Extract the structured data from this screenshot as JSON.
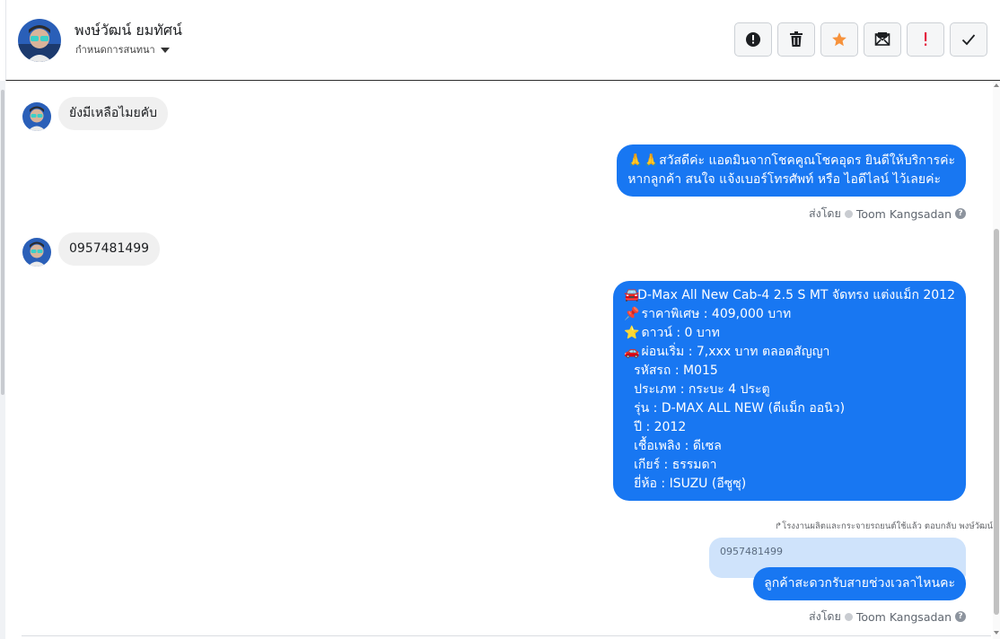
{
  "header": {
    "contact_name": "พงษ์วัฒน์ ยมทัศน์",
    "assign_label": "กำหนดการสนทนา"
  },
  "actions": [
    {
      "name": "mark-spam-button",
      "icon": "alert-circle-icon"
    },
    {
      "name": "delete-button",
      "icon": "trash-icon"
    },
    {
      "name": "star-button",
      "icon": "star-icon",
      "color": "#f7923b"
    },
    {
      "name": "mark-unread-button",
      "icon": "mail-icon"
    },
    {
      "name": "follow-up-button",
      "icon": "exclamation-icon",
      "color": "#e41e3f"
    },
    {
      "name": "mark-done-button",
      "icon": "check-icon"
    }
  ],
  "messages": {
    "m1": {
      "text": "ยังมีเหลือไมยคับ"
    },
    "m2": {
      "lines": [
        "สวัสดีค่ะ แอดมินจากโชคคูณโชคอุดร ยินดีให้บริการค่ะ",
        "หากลูกค้า สนใจ แจ้งเบอร์โทรศัพท์ หรือ ไอดีไลน์  ไว้เลยค่ะ"
      ],
      "emoji_prefix": "🙏🙏"
    },
    "m3": {
      "text": "0957481499"
    },
    "m4": {
      "lines": [
        "D-Max All New Cab-4 2.5 S MT จัดทรง แต่งแม็ก 2012",
        " ราคาพิเศษ : 409,000 บาท",
        " ดาวน์ : 0 บาท",
        " ผ่อนเริ่ม : 7,xxx บาท ตลอดสัญญา",
        "รหัสรถ : M015",
        "ประเภท : กระบะ 4 ประตู",
        "รุ่น : D-MAX ALL NEW (ดีแม็ก ออนิว)",
        "ปี : 2012",
        "เชื้อเพลิง : ดีเซล",
        "เกียร์ : ธรรมดา",
        "ยี่ห้อ : ISUZU (อีซูซุ)"
      ],
      "emojis": [
        "🚘",
        "📌",
        "⭐",
        "🚗"
      ]
    },
    "reply_note": "↱โรงงานผลิตและกระจายรถยนต์ใช้แล้ว ตอบกลับ พงษ์วัฒน์",
    "quoted_text": "0957481499",
    "m5": {
      "text": "ลูกค้าสะดวกรับสายช่วงเวลาไหนคะ"
    }
  },
  "sent_by": {
    "prefix": "ส่งโดย",
    "agent": "Toom Kangsadan"
  }
}
